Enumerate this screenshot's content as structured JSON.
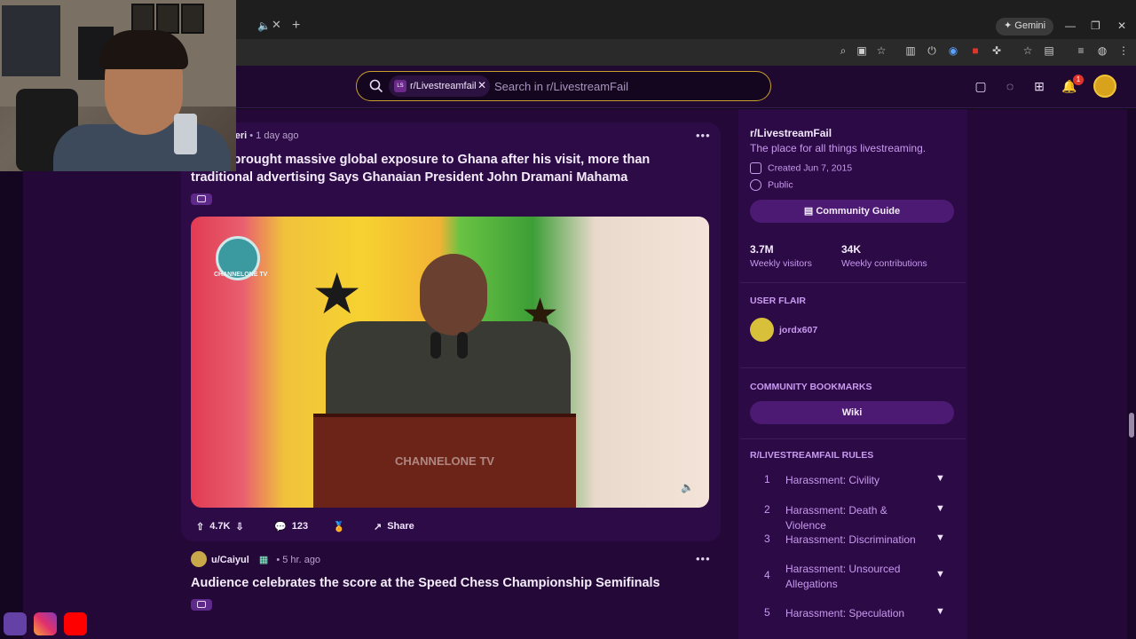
{
  "browser": {
    "tab_mute_icon": "speaker-icon",
    "tab_close": "✕",
    "new_tab": "+",
    "gemini_label": "Gemini",
    "window_controls": [
      "—",
      "❐",
      "✕"
    ]
  },
  "header": {
    "search_chip": "r/Livestreamfail",
    "search_chip_avatar": "LS",
    "search_placeholder": "Search in r/LivestreamFail",
    "notification_count": "1"
  },
  "post1": {
    "author": "geri",
    "time": "• 1 day ago",
    "title": "Speed brought massive global exposure to Ghana after his visit, more than traditional advertising Says Ghanaian President John Dramani Mahama",
    "video_logo_text": "CHANNELONE TV",
    "video_watermark": "CHANNELONE TV",
    "upvotes": "4.7K",
    "comments": "123",
    "share_label": "Share"
  },
  "post2": {
    "author": "u/Caiyul",
    "time": "• 5 hr. ago",
    "title": "Audience celebrates the score at the Speed Chess Championship Semifinals"
  },
  "sidebar": {
    "name": "r/LivestreamFail",
    "description": "The place for all things livestreaming.",
    "created": "Created Jun 7, 2015",
    "visibility": "Public",
    "guide_button": "Community Guide",
    "stats": [
      {
        "value": "3.7M",
        "label": "Weekly visitors"
      },
      {
        "value": "34K",
        "label": "Weekly contributions"
      }
    ],
    "user_flair_heading": "USER FLAIR",
    "user_flair_name": "jordx607",
    "bookmarks_heading": "COMMUNITY BOOKMARKS",
    "bookmark_wiki": "Wiki",
    "rules_heading": "R/LIVESTREAMFAIL RULES",
    "rules": [
      {
        "num": "1",
        "text": "Harassment: Civility"
      },
      {
        "num": "2",
        "text": "Harassment: Death & Violence"
      },
      {
        "num": "3",
        "text": "Harassment: Discrimination"
      },
      {
        "num": "4",
        "text": "Harassment: Unsourced Allegations"
      },
      {
        "num": "5",
        "text": "Harassment: Speculation"
      }
    ]
  },
  "colors": {
    "page_bg": "#240838",
    "card_bg": "#2d0b47",
    "accent": "#c89af0",
    "search_border": "#c8a12a"
  }
}
